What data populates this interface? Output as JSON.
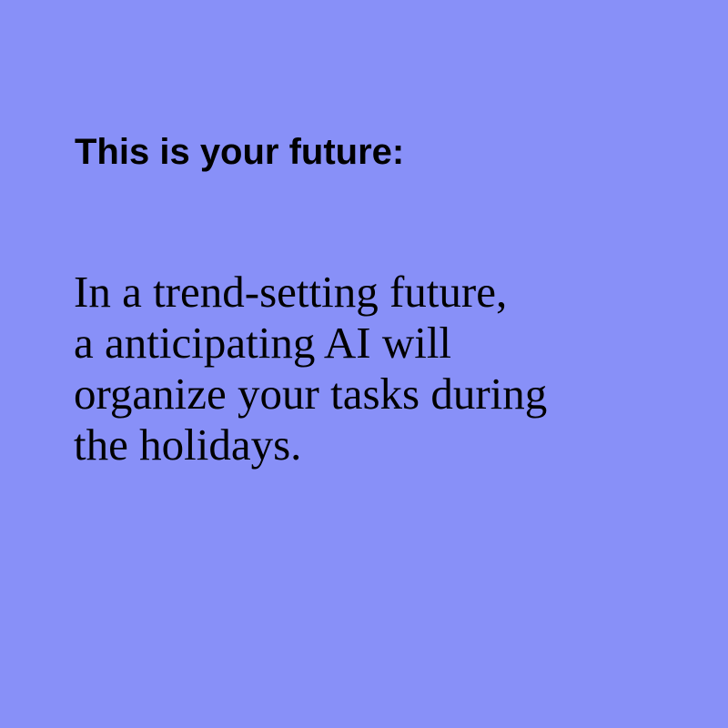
{
  "theme": {
    "background": "#8890f8",
    "text_color": "#000000"
  },
  "heading": "This is your future:",
  "body": {
    "lines": [
      "In a trend-setting future,",
      "a anticipating AI will",
      "organize your tasks during",
      "the holidays."
    ]
  }
}
